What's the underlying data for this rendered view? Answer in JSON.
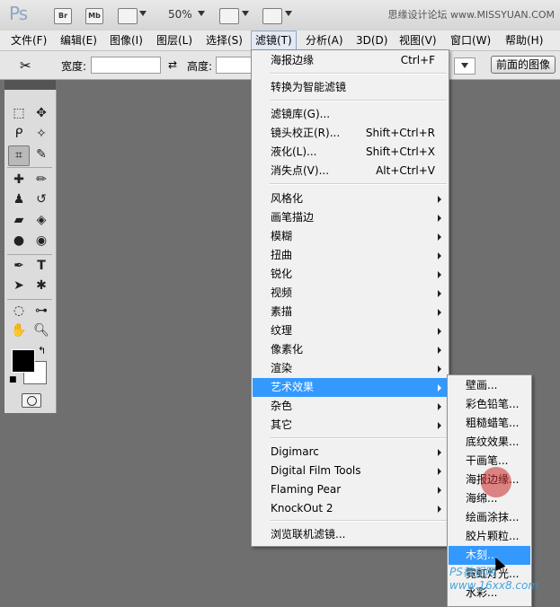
{
  "appbar": {
    "logo": "Ps",
    "bridge_label": "Br",
    "minibridge_label": "Mb",
    "zoom": "50%",
    "watermark": "思缘设计论坛 www.MISSYUAN.COM"
  },
  "menubar": {
    "items": [
      {
        "label": "文件(F)"
      },
      {
        "label": "编辑(E)"
      },
      {
        "label": "图像(I)"
      },
      {
        "label": "图层(L)"
      },
      {
        "label": "选择(S)"
      },
      {
        "label": "滤镜(T)"
      },
      {
        "label": "分析(A)"
      },
      {
        "label": "3D(D)"
      },
      {
        "label": "视图(V)"
      },
      {
        "label": "窗口(W)"
      },
      {
        "label": "帮助(H)"
      }
    ]
  },
  "options": {
    "width_label": "宽度:",
    "height_label": "高度:",
    "front_image_label": "前面的图像"
  },
  "tools": {
    "icons": [
      "marquee-icon",
      "move-icon",
      "lasso-icon",
      "magic-wand-icon",
      "crop-icon",
      "eyedropper-icon",
      "healing-brush-icon",
      "brush-icon",
      "clone-stamp-icon",
      "history-brush-icon",
      "eraser-icon",
      "paint-bucket-icon",
      "blur-icon",
      "dodge-icon",
      "pen-icon",
      "type-icon",
      "path-selection-icon",
      "shape-icon",
      "3d-rotate-icon",
      "3d-orbit-icon",
      "hand-icon",
      "zoom-icon"
    ]
  },
  "filter_menu": {
    "items": [
      {
        "label": "海报边缘",
        "shortcut": "Ctrl+F"
      },
      {
        "label": "转换为智能滤镜"
      },
      {
        "label": "滤镜库(G)..."
      },
      {
        "label": "镜头校正(R)...",
        "shortcut": "Shift+Ctrl+R"
      },
      {
        "label": "液化(L)...",
        "shortcut": "Shift+Ctrl+X"
      },
      {
        "label": "消失点(V)...",
        "shortcut": "Alt+Ctrl+V"
      },
      {
        "label": "风格化"
      },
      {
        "label": "画笔描边"
      },
      {
        "label": "模糊"
      },
      {
        "label": "扭曲"
      },
      {
        "label": "锐化"
      },
      {
        "label": "视频"
      },
      {
        "label": "素描"
      },
      {
        "label": "纹理"
      },
      {
        "label": "像素化"
      },
      {
        "label": "渲染"
      },
      {
        "label": "艺术效果"
      },
      {
        "label": "杂色"
      },
      {
        "label": "其它"
      },
      {
        "label": "Digimarc"
      },
      {
        "label": "Digital Film Tools"
      },
      {
        "label": "Flaming Pear"
      },
      {
        "label": "KnockOut 2"
      },
      {
        "label": "浏览联机滤镜..."
      }
    ]
  },
  "artistic_submenu": {
    "items": [
      {
        "label": "壁画..."
      },
      {
        "label": "彩色铅笔..."
      },
      {
        "label": "粗糙蜡笔..."
      },
      {
        "label": "底纹效果..."
      },
      {
        "label": "干画笔..."
      },
      {
        "label": "海报边缘..."
      },
      {
        "label": "海绵..."
      },
      {
        "label": "绘画涂抹..."
      },
      {
        "label": "胶片颗粒..."
      },
      {
        "label": "木刻..."
      },
      {
        "label": "霓虹灯光..."
      },
      {
        "label": "水彩..."
      }
    ]
  },
  "overlay": {
    "watermark_bottom": "PS教程网 www.16xx8.com"
  }
}
